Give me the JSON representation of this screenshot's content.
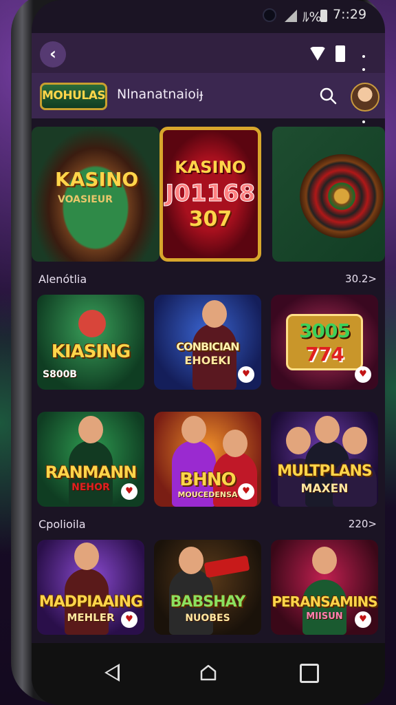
{
  "status_bar": {
    "battery_text": "ﾙ%",
    "time": "7::29"
  },
  "header": {
    "logo_text": "MOHULAS",
    "title": "Nlnanatnaioiɟ"
  },
  "banners": [
    {
      "title": "KASINO",
      "subtitle": "VOASIEUR"
    },
    {
      "title": "KASINO",
      "line1": "J01168",
      "line2": "307"
    },
    {
      "title": ""
    }
  ],
  "sections": [
    {
      "title": "Alenótlia",
      "count": "30.2>",
      "tiles": [
        {
          "title": "KIASING",
          "subtitle": "S800B",
          "accent": "#1e6b3a"
        },
        {
          "title": "CONBICIAN",
          "subtitle": "EHOEKI",
          "accent": "#1e3d8a"
        },
        {
          "title": "3005",
          "subtitle": "774",
          "accent": "#6a1040"
        },
        {
          "title": "RANMANN",
          "subtitle": "NEHOR",
          "accent": "#1f6b3a"
        },
        {
          "title": "BHNO",
          "subtitle": "MOUCEDENSA",
          "accent": "#8a3a12"
        },
        {
          "title": "MULTPLANS",
          "subtitle": "MAXEN",
          "accent": "#3a1c5a"
        }
      ]
    },
    {
      "title": "Cpolioila",
      "count": "220>",
      "tiles": [
        {
          "title": "MADPIAAING",
          "subtitle": "MEHLER",
          "accent": "#4a1f6b"
        },
        {
          "title": "BABSHAY",
          "subtitle": "NUOBES",
          "accent": "#3a2a10"
        },
        {
          "title": "PERANSAMINS",
          "subtitle": "MIISUN",
          "accent": "#6a1030"
        }
      ]
    }
  ],
  "colors": {
    "header_bg": "#3b2750",
    "gold": "#ffd54a",
    "screen_bg": "#1b1424"
  }
}
